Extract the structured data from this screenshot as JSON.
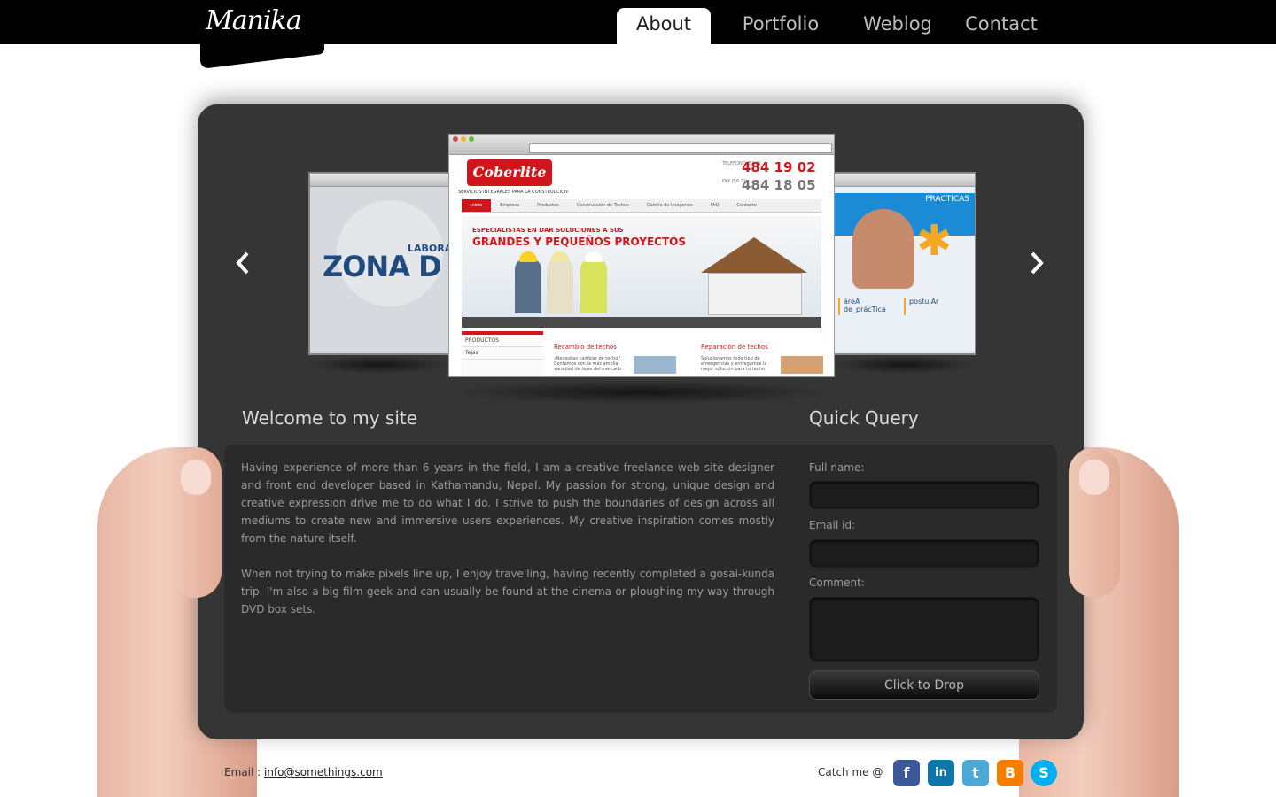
{
  "brand": {
    "logo_text": "Manika"
  },
  "nav": {
    "items": [
      {
        "label": "About",
        "active": true
      },
      {
        "label": "Portfolio",
        "active": false
      },
      {
        "label": "Weblog",
        "active": false
      },
      {
        "label": "Contact",
        "active": false
      }
    ]
  },
  "carousel": {
    "prev_icon": "chevron-left-icon",
    "next_icon": "chevron-right-icon",
    "left_slide": {
      "brand": "ZONA D",
      "subtitle": "LABORAT"
    },
    "center_slide": {
      "logo": "Coberlite",
      "tagline": "SERVICIOS INTEGRALES PARA LA CONSTRUCCION",
      "phone_label": "TELEFONO [56 2]",
      "phone": "484 19 02",
      "fax_label": "FAX [56 2]",
      "fax": "484 18 05",
      "menu": [
        "Inicio",
        "Empresa",
        "Productos",
        "Construcción de Techos",
        "Galería de Imágenes",
        "FAQ",
        "Contacto"
      ],
      "banner_line1": "ESPECIALISTAS EN DAR SOLUCIONES A SUS",
      "banner_line2": "GRANDES Y PEQUEÑOS PROYECTOS",
      "sidebar_title": "PRODUCTOS",
      "sidebar_item": "Tejas",
      "col1_title": "Recambio de techos",
      "col1_text": "¿Necesitas cambiar de techo? Contamos con la más amplia variedad de tejas del mercado",
      "col2_title": "Reparación de techos",
      "col2_text": "Solucionamos todo tipo de emergencias y entregamos la mejor solución para tu techo"
    },
    "right_slide": {
      "title": "PRACTICAS",
      "box1": "áreA de_prácTica",
      "box2": "postulAr"
    }
  },
  "welcome": {
    "title": "Welcome to my site",
    "paragraph1": "Having experience of more than 6 years in the field, I am a creative freelance web site designer and front end developer based in Kathamandu, Nepal. My passion for strong, unique design and creative expression drive me to do what I do. I strive to push the boundaries of design across all mediums to create new and immersive users experiences. My creative inspiration comes mostly from the nature itself.",
    "paragraph2": "When not trying to make pixels line up, I enjoy travelling, having recently completed a gosai-kunda trip. I'm also a big film geek and can usually be found at the cinema or ploughing my way through DVD box sets."
  },
  "query": {
    "title": "Quick Query",
    "full_name_label": "Full name:",
    "full_name_value": "",
    "email_label": "Email id:",
    "email_value": "",
    "comment_label": "Comment:",
    "comment_value": "",
    "submit_label": "Click to Drop"
  },
  "footer": {
    "email_prefix": "Email :",
    "email": "info@somethings.com",
    "catch_me": "Catch me @",
    "socials": [
      {
        "name": "facebook-icon",
        "glyph": "f",
        "color": "#3b5998"
      },
      {
        "name": "linkedin-icon",
        "glyph": "in",
        "color": "#0e76a8"
      },
      {
        "name": "twitter-icon",
        "glyph": "t",
        "color": "#4aa9d8"
      },
      {
        "name": "blogger-icon",
        "glyph": "B",
        "color": "#f57d00"
      },
      {
        "name": "skype-icon",
        "glyph": "S",
        "color": "#00aff0"
      }
    ]
  }
}
